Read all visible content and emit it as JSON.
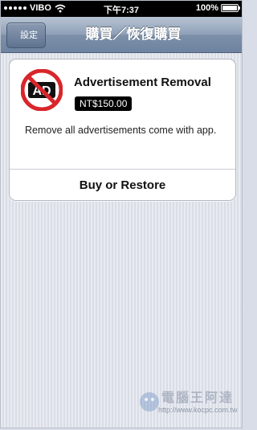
{
  "status_bar": {
    "carrier": "VIBO",
    "time": "下午7:37",
    "battery": "100%"
  },
  "nav": {
    "back_label": "設定",
    "title": "購買／恢復購買"
  },
  "product": {
    "icon_text": "AD",
    "name": "Advertisement Removal",
    "price": "NT$150.00",
    "description": "Remove all advertisements come with app.",
    "action_label": "Buy or Restore"
  },
  "watermark": {
    "brand": "電腦王阿達",
    "url": "http://www.kocpc.com.tw"
  },
  "colors": {
    "navbar": "#7d90aa",
    "no_sign_red": "#d8262b"
  }
}
